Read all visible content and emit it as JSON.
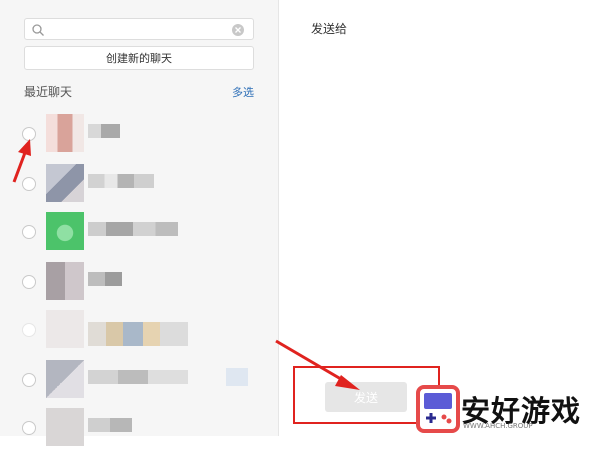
{
  "sidebar": {
    "search": {
      "value": "",
      "placeholder": ""
    },
    "new_chat_label": "创建新的聊天",
    "section_title": "最近聊天",
    "multi_select_label": "多选",
    "contacts": [
      {
        "avatar_color": "#d9a39a"
      },
      {
        "avatar_color": "#9aa0b3"
      },
      {
        "avatar_color": "#4cc36a"
      },
      {
        "avatar_color": "#a8a0a4"
      },
      {
        "avatar_color": "#e9e4e4"
      },
      {
        "avatar_color": "#b3b6c0"
      },
      {
        "avatar_color": "#d9d6d6"
      }
    ]
  },
  "main": {
    "title": "发送给",
    "send_label": "发送"
  },
  "watermark": {
    "brand_text": "安好游戏",
    "brand_sub": "WWW.AHCH.GROUP"
  },
  "colors": {
    "accent_link": "#2e6fb7",
    "annotation_red": "#e0231f",
    "send_disabled": "#e6e6e6"
  },
  "icons": [
    "search-icon",
    "clear-icon",
    "radio-icon",
    "arrow-annotation",
    "gamepad-logo-icon"
  ]
}
